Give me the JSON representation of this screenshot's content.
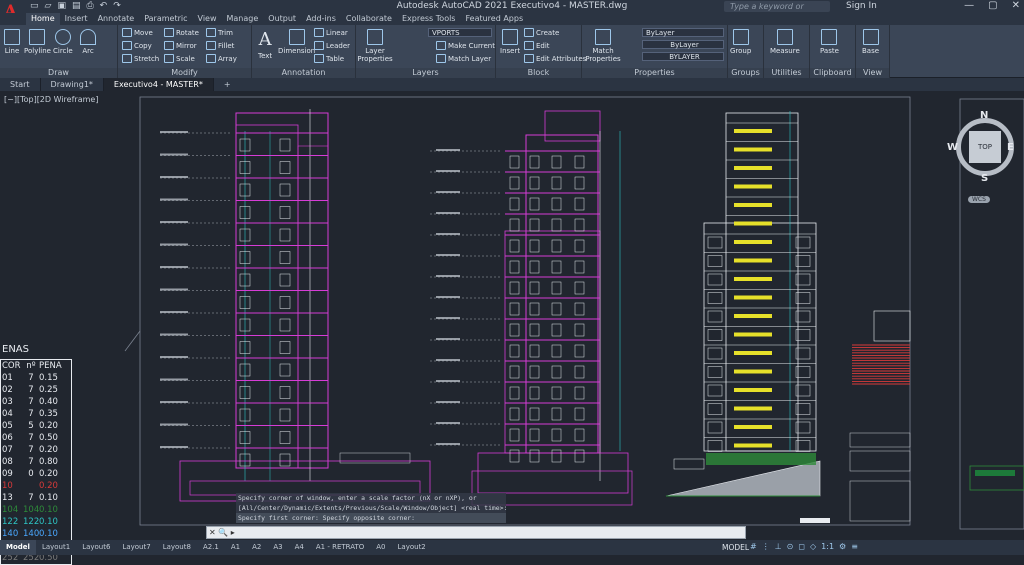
{
  "app": {
    "title": "Autodesk AutoCAD 2021   Executivo4 - MASTER.dwg",
    "search_placeholder": "Type a keyword or phrase",
    "signin": "Sign In"
  },
  "ribbon_tabs": [
    "Home",
    "Insert",
    "Annotate",
    "Parametric",
    "View",
    "Manage",
    "Output",
    "Add-ins",
    "Collaborate",
    "Express Tools",
    "Featured Apps"
  ],
  "panels": {
    "draw": {
      "title": "Draw",
      "line": "Line",
      "polyline": "Polyline",
      "circle": "Circle",
      "arc": "Arc"
    },
    "modify": {
      "title": "Modify",
      "move": "Move",
      "rotate": "Rotate",
      "trim": "Trim",
      "copy": "Copy",
      "mirror": "Mirror",
      "fillet": "Fillet",
      "stretch": "Stretch",
      "scale": "Scale",
      "array": "Array"
    },
    "annotation": {
      "title": "Annotation",
      "text": "Text",
      "dimension": "Dimension",
      "linear": "Linear",
      "leader": "Leader",
      "table": "Table"
    },
    "layers": {
      "title": "Layers",
      "layer_props": "Layer Properties",
      "current_layer": "VPORTS",
      "make_current": "Make Current",
      "match_layer": "Match Layer"
    },
    "block": {
      "title": "Block",
      "insert": "Insert",
      "create": "Create",
      "edit": "Edit",
      "edit_attr": "Edit Attributes"
    },
    "properties": {
      "title": "Properties",
      "match": "Match Properties",
      "color": "ByLayer",
      "linetype": "ByLayer",
      "lineweight": "BYLAYER"
    },
    "groups": {
      "title": "Groups",
      "group": "Group"
    },
    "utilities": {
      "title": "Utilities",
      "measure": "Measure"
    },
    "clipboard": {
      "title": "Clipboard",
      "paste": "Paste"
    },
    "view": {
      "title": "View",
      "base": "Base"
    }
  },
  "doc_tabs": [
    "Start",
    "Drawing1*",
    "Executivo4 - MASTER*"
  ],
  "viewport_label": "[−][Top][2D Wireframe]",
  "navcube": {
    "top": "TOP",
    "n": "N",
    "s": "S",
    "e": "E",
    "w": "W",
    "wcs": "WCS"
  },
  "pen_table": {
    "title": "ENAS",
    "headers": [
      "COR",
      "nº",
      "PENA"
    ],
    "rows": [
      [
        "01",
        "7",
        "0.15"
      ],
      [
        "02",
        "7",
        "0.25"
      ],
      [
        "03",
        "7",
        "0.40"
      ],
      [
        "04",
        "7",
        "0.35"
      ],
      [
        "05",
        "5",
        "0.20"
      ],
      [
        "06",
        "7",
        "0.50"
      ],
      [
        "07",
        "7",
        "0.20"
      ],
      [
        "08",
        "7",
        "0.80"
      ],
      [
        "09",
        "0",
        "0.20"
      ],
      [
        "10",
        "",
        "0.20"
      ],
      [
        "13",
        "7",
        "0.10"
      ],
      [
        "104",
        "104",
        "0.10"
      ],
      [
        "122",
        "122",
        "0.10"
      ],
      [
        "140",
        "140",
        "0.10"
      ],
      [
        "253",
        "253",
        "0.20"
      ],
      [
        "252",
        "252",
        "0.50"
      ]
    ],
    "row_colors": [
      "#e8ebf0",
      "#e8ebf0",
      "#e8ebf0",
      "#e8ebf0",
      "#e8ebf0",
      "#e8ebf0",
      "#e8ebf0",
      "#e8ebf0",
      "#e8ebf0",
      "#d83a3a",
      "#e8ebf0",
      "#2e8b3a",
      "#2ec4c4",
      "#4aa8ff",
      "#b5b5b5",
      "#7a7a7a"
    ]
  },
  "command_history": [
    "Specify corner of window, enter a scale factor (nX or nXP), or",
    "[All/Center/Dynamic/Extents/Previous/Scale/Window/Object] <real time>: W",
    "Specify first corner: Specify opposite corner:"
  ],
  "layout_tabs": [
    "Model",
    "Layout1",
    "Layout6",
    "Layout7",
    "Layout8",
    "A2.1",
    "A1",
    "A2",
    "A3",
    "A4",
    "A1 - RETRATO",
    "A0",
    "Layout2"
  ],
  "status": {
    "model": "MODEL",
    "scale": "1:1"
  }
}
